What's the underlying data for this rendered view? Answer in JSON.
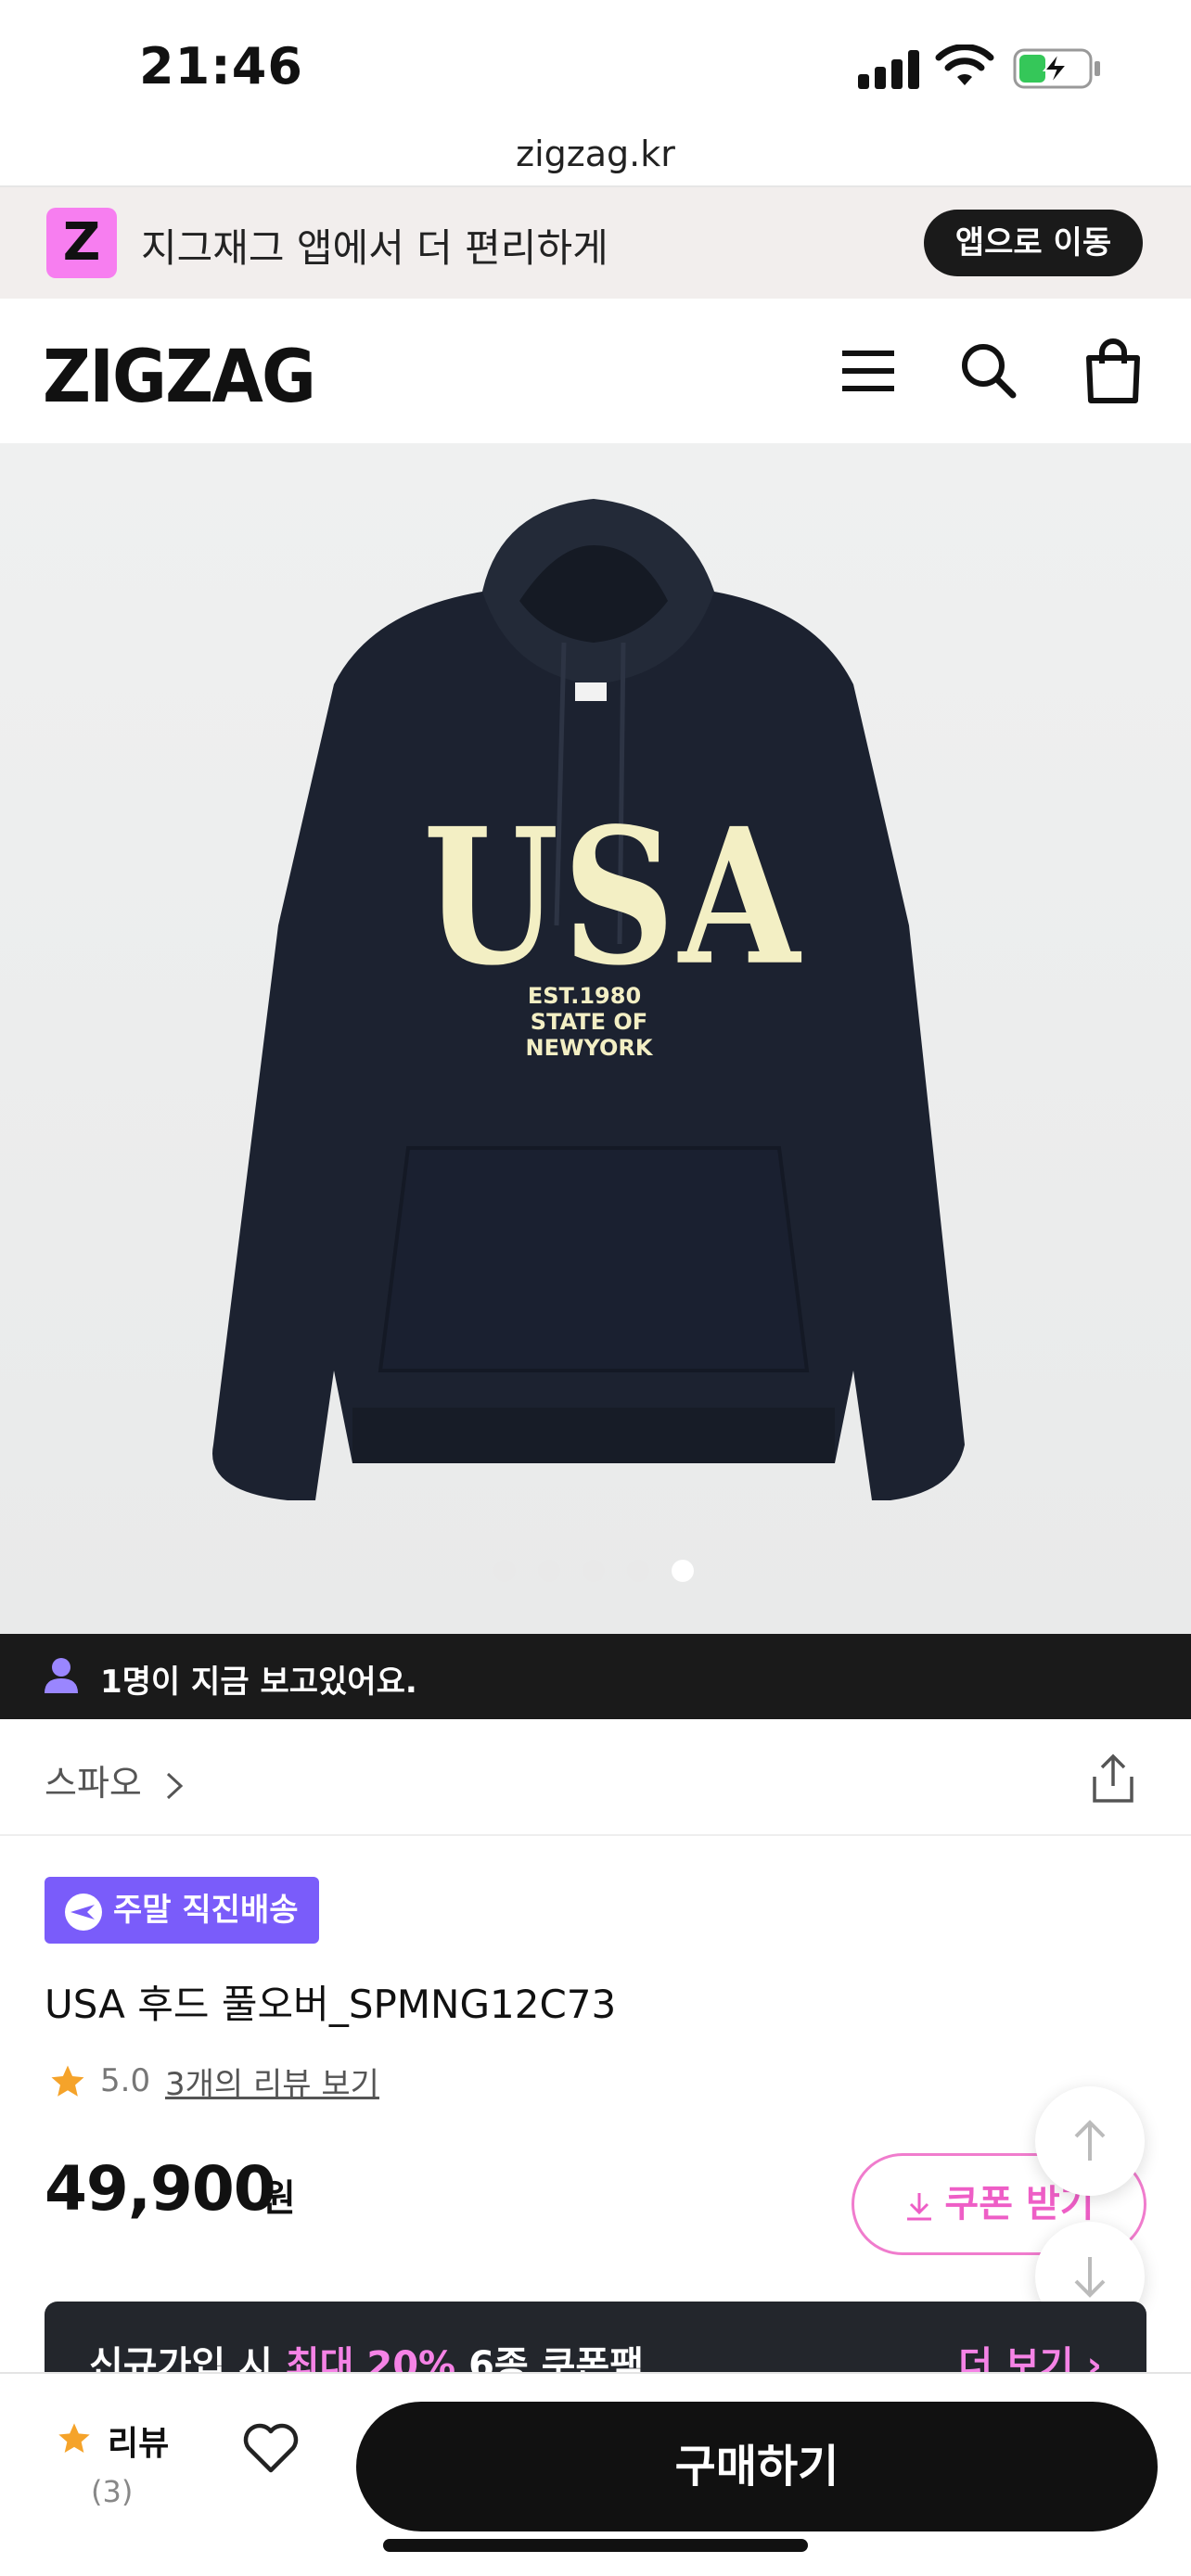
{
  "status_bar": {
    "time": "21:46"
  },
  "browser": {
    "url": "zigzag.kr"
  },
  "app_banner": {
    "logo_letter": "Z",
    "text": "지그재그 앱에서 더 편리하게",
    "button": "앱으로 이동"
  },
  "header": {
    "brand": "ZIGZAG",
    "icons": [
      "menu-icon",
      "search-icon",
      "shopping-bag-icon"
    ]
  },
  "product_image": {
    "description_icon": "navy-hoodie-image",
    "print_main": "USA",
    "print_line1": "EST.1980",
    "print_line2": "STATE OF NEWYORK",
    "carousel": {
      "total": 5,
      "active_index": 4
    }
  },
  "viewers": {
    "text": "1명이 지금 보고있어요."
  },
  "brand_row": {
    "brand_name": "스파오"
  },
  "product": {
    "badge": "주말 직진배송",
    "name": "USA 후드 풀오버_SPMNG12C73",
    "rating": "5.0",
    "review_link": "3개의 리뷰 보기",
    "price": "49,900",
    "price_unit": "원",
    "coupon_button": "쿠폰 받기"
  },
  "coupon_bar": {
    "text_before": "신규가입 시 ",
    "text_highlight": "최대 20%",
    "text_after": " 6종 쿠폰팩",
    "more": "더 보기"
  },
  "bottom_bar": {
    "review_label": "리뷰",
    "review_count": "(3)",
    "buy_button": "구매하기"
  },
  "colors": {
    "accent_pink": "#f583e6",
    "badge_purple": "#7a5cfa",
    "dark": "#111111"
  }
}
